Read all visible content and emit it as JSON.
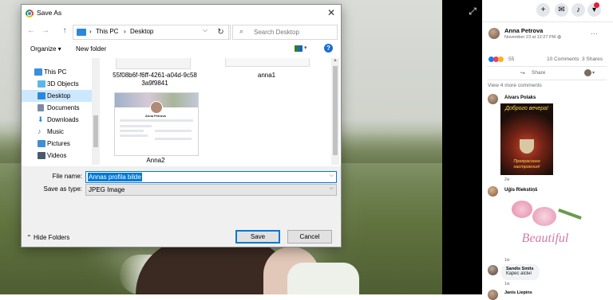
{
  "dialog": {
    "title": "Save As",
    "close_glyph": "✕",
    "nav": {
      "back": "←",
      "forward": "→",
      "up": "↑"
    },
    "address": {
      "sep1": "›",
      "pc": "This PC",
      "sep2": "›",
      "folder": "Desktop",
      "dropdown": "⌵"
    },
    "refresh": "↻",
    "search_placeholder": "Search Desktop",
    "toolbar": {
      "organize": "Organize ▾",
      "new_folder": "New folder",
      "help": "?"
    },
    "sidebar": [
      {
        "label": "This PC",
        "icon": "computer-icon",
        "color": "#3a8edb"
      },
      {
        "label": "3D Objects",
        "icon": "cube-icon",
        "color": "#5cb7e8"
      },
      {
        "label": "Desktop",
        "icon": "desktop-icon",
        "color": "#2b88d8"
      },
      {
        "label": "Documents",
        "icon": "document-icon",
        "color": "#7a8ca3"
      },
      {
        "label": "Downloads",
        "icon": "download-icon",
        "color": "#2b88d8"
      },
      {
        "label": "Music",
        "icon": "music-icon",
        "color": "#2b7fd3"
      },
      {
        "label": "Pictures",
        "icon": "pictures-icon",
        "color": "#3d8fd6"
      },
      {
        "label": "Videos",
        "icon": "video-icon",
        "color": "#4a5a6d"
      }
    ],
    "files": [
      {
        "name_line1": "55f08b6f-f6ff-4261-a04d-9c58",
        "name_line2": "3a9f9841"
      },
      {
        "name_line1": "anna1"
      },
      {
        "name_line1": "Anna2"
      }
    ],
    "file_name_label": "File name:",
    "file_name_value": "Annas profila bilde",
    "save_type_label": "Save as type:",
    "save_type_value": "JPEG Image",
    "hide_folders": "Hide Folders",
    "save": "Save",
    "cancel": "Cancel"
  },
  "facebook": {
    "author": "Anna Petrova",
    "date": "November 23 at 12:27 PM · ",
    "reactions_count": "55",
    "comments": "10 Comments",
    "shares": "3 Shares",
    "share_label": "Share",
    "view_more": "View 4 more comments",
    "comments_list": [
      {
        "name": "Aivars Polaks",
        "time": "2w",
        "image_text_top": "Доброго вечера!",
        "image_text_bottom": "Прекрасного настроения!"
      },
      {
        "name": "Uģis Riekstiņš",
        "time": "1w",
        "image_text": "Beautiful"
      },
      {
        "name": "Sandis Smits",
        "text": "Карес аісіні",
        "time": "1w"
      },
      {
        "name": "Janis Liepins"
      }
    ],
    "colors": {
      "accent": "#1877f2",
      "reaction_like": "#1877f2",
      "reaction_love": "#f33e58",
      "reaction_haha": "#f7b125"
    }
  }
}
